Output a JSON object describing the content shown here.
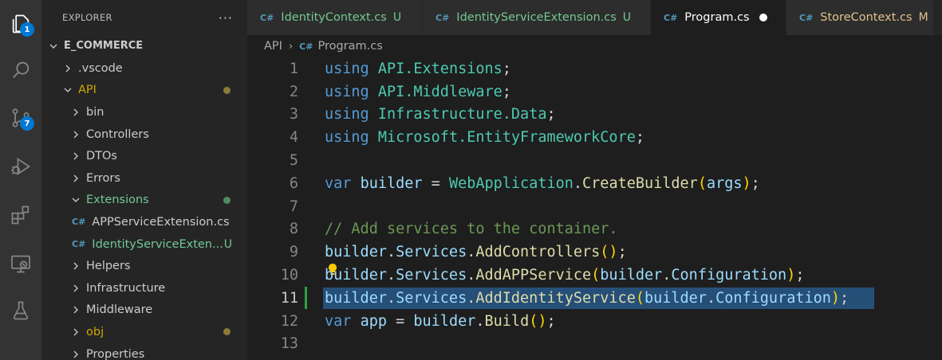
{
  "activity_bar": {
    "items": [
      {
        "name": "explorer-icon",
        "badge": "1"
      },
      {
        "name": "search-icon",
        "badge": null
      },
      {
        "name": "source-control-icon",
        "badge": "7"
      },
      {
        "name": "run-debug-icon",
        "badge": null
      },
      {
        "name": "extensions-icon",
        "badge": null
      },
      {
        "name": "remote-explorer-icon",
        "badge": null
      },
      {
        "name": "testing-icon",
        "badge": null
      }
    ]
  },
  "sidebar": {
    "title": "EXPLORER",
    "more": "···",
    "root": "E_COMMERCE",
    "items": [
      {
        "label": ".vscode",
        "type": "folder",
        "color": "#cccccc",
        "status": "",
        "status_color": ""
      },
      {
        "label": "API",
        "type": "folder-open",
        "color": "#cca700",
        "status": "dot",
        "status_color": "#8c7a3a"
      },
      {
        "label": "bin",
        "type": "folder",
        "color": "#cccccc",
        "status": "",
        "status_color": ""
      },
      {
        "label": "Controllers",
        "type": "folder",
        "color": "#cccccc",
        "status": "",
        "status_color": ""
      },
      {
        "label": "DTOs",
        "type": "folder",
        "color": "#cccccc",
        "status": "",
        "status_color": ""
      },
      {
        "label": "Errors",
        "type": "folder",
        "color": "#cccccc",
        "status": "",
        "status_color": ""
      },
      {
        "label": "Extensions",
        "type": "folder-open",
        "color": "#73c991",
        "status": "dot",
        "status_color": "#4e8a5e"
      },
      {
        "label": "APPServiceExtension.cs",
        "type": "cs",
        "color": "#cccccc",
        "status": "",
        "status_color": ""
      },
      {
        "label": "IdentityServiceExten...",
        "type": "cs",
        "color": "#73c991",
        "status": "U",
        "status_color": "#73c991"
      },
      {
        "label": "Helpers",
        "type": "folder",
        "color": "#cccccc",
        "status": "",
        "status_color": ""
      },
      {
        "label": "Infrastructure",
        "type": "folder",
        "color": "#cccccc",
        "status": "",
        "status_color": ""
      },
      {
        "label": "Middleware",
        "type": "folder",
        "color": "#cccccc",
        "status": "",
        "status_color": ""
      },
      {
        "label": "obj",
        "type": "folder",
        "color": "#cca700",
        "status": "dot",
        "status_color": "#8c7a3a"
      },
      {
        "label": "Properties",
        "type": "folder",
        "color": "#cccccc",
        "status": "",
        "status_color": ""
      }
    ]
  },
  "tabs": [
    {
      "label": "IdentityContext.cs",
      "status": "U",
      "active": false,
      "color": "#73c991",
      "status_color": "#73c991"
    },
    {
      "label": "IdentityServiceExtension.cs",
      "status": "U",
      "active": false,
      "color": "#73c991",
      "status_color": "#73c991"
    },
    {
      "label": "Program.cs",
      "status": "",
      "active": true,
      "color": "#ffffff",
      "status_color": ""
    },
    {
      "label": "StoreContext.cs",
      "status": "M",
      "active": false,
      "color": "#e2c08d",
      "status_color": "#e2c08d"
    }
  ],
  "breadcrumb": {
    "folder": "API",
    "separator": "›",
    "file": "Program.cs"
  },
  "editor": {
    "current_line": 11,
    "lines": [
      {
        "n": "1",
        "tokens": [
          [
            "kw",
            "using"
          ],
          [
            "pl",
            " "
          ],
          [
            "ty",
            "API.Extensions"
          ],
          [
            "pl",
            ";"
          ]
        ]
      },
      {
        "n": "2",
        "tokens": [
          [
            "kw",
            "using"
          ],
          [
            "pl",
            " "
          ],
          [
            "ty",
            "API.Middleware"
          ],
          [
            "pl",
            ";"
          ]
        ]
      },
      {
        "n": "3",
        "tokens": [
          [
            "kw",
            "using"
          ],
          [
            "pl",
            " "
          ],
          [
            "ty",
            "Infrastructure.Data"
          ],
          [
            "pl",
            ";"
          ]
        ]
      },
      {
        "n": "4",
        "tokens": [
          [
            "kw",
            "using"
          ],
          [
            "pl",
            " "
          ],
          [
            "ty",
            "Microsoft.EntityFrameworkCore"
          ],
          [
            "pl",
            ";"
          ]
        ]
      },
      {
        "n": "5",
        "tokens": []
      },
      {
        "n": "6",
        "tokens": [
          [
            "kw",
            "var"
          ],
          [
            "pl",
            " "
          ],
          [
            "id",
            "builder"
          ],
          [
            "pl",
            " = "
          ],
          [
            "ty",
            "WebApplication"
          ],
          [
            "pl",
            "."
          ],
          [
            "fn",
            "CreateBuilder"
          ],
          [
            "br",
            "("
          ],
          [
            "id",
            "args"
          ],
          [
            "br",
            ")"
          ],
          [
            "pl",
            ";"
          ]
        ]
      },
      {
        "n": "7",
        "tokens": []
      },
      {
        "n": "8",
        "tokens": [
          [
            "cm",
            "// Add services to the container."
          ]
        ]
      },
      {
        "n": "9",
        "tokens": [
          [
            "id",
            "builder"
          ],
          [
            "pl",
            "."
          ],
          [
            "id",
            "Services"
          ],
          [
            "pl",
            "."
          ],
          [
            "fn",
            "AddControllers"
          ],
          [
            "br",
            "()"
          ],
          [
            "pl",
            ";"
          ]
        ]
      },
      {
        "n": "10",
        "tokens": [
          [
            "id",
            "builder"
          ],
          [
            "pl",
            "."
          ],
          [
            "id",
            "Services"
          ],
          [
            "pl",
            "."
          ],
          [
            "fn",
            "AddAPPService"
          ],
          [
            "br",
            "("
          ],
          [
            "id",
            "builder"
          ],
          [
            "pl",
            "."
          ],
          [
            "id",
            "Configuration"
          ],
          [
            "br",
            ")"
          ],
          [
            "pl",
            ";"
          ]
        ]
      },
      {
        "n": "11",
        "tokens": [
          [
            "id",
            "builder"
          ],
          [
            "pl",
            "."
          ],
          [
            "id",
            "Services"
          ],
          [
            "pl",
            "."
          ],
          [
            "fn",
            "AddIdentityService"
          ],
          [
            "br",
            "("
          ],
          [
            "id",
            "builder"
          ],
          [
            "pl",
            "."
          ],
          [
            "id",
            "Configuration"
          ],
          [
            "br",
            ")"
          ],
          [
            "pl",
            ";"
          ]
        ]
      },
      {
        "n": "12",
        "tokens": [
          [
            "kw",
            "var"
          ],
          [
            "pl",
            " "
          ],
          [
            "id",
            "app"
          ],
          [
            "pl",
            " = "
          ],
          [
            "id",
            "builder"
          ],
          [
            "pl",
            "."
          ],
          [
            "fn",
            "Build"
          ],
          [
            "br",
            "()"
          ],
          [
            "pl",
            ";"
          ]
        ]
      },
      {
        "n": "13",
        "tokens": []
      }
    ]
  },
  "colors": {
    "activity_bar": "#333333",
    "sidebar": "#252526",
    "editor": "#1e1e1e",
    "selection": "#264f78",
    "badge": "#0078d4",
    "untracked": "#73c991",
    "modified": "#e2c08d"
  }
}
